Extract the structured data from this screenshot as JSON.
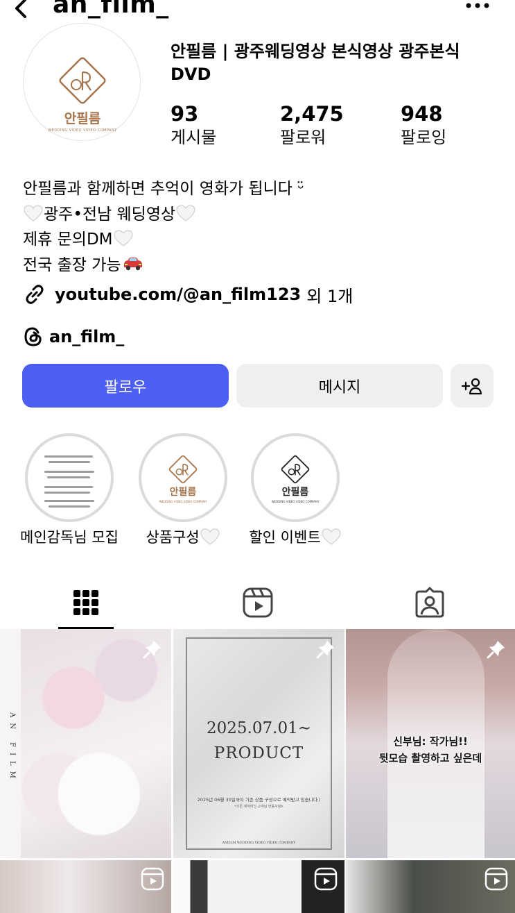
{
  "header": {
    "username": "an_film_"
  },
  "profile": {
    "avatar_logo_word": "안필름",
    "avatar_logo_sub": "WEDDING VIDEO VIDEO COMPANY",
    "display_name": "안필름 | 광주웨딩영상 본식영상 광주본식 DVD",
    "stats": [
      {
        "value": "93",
        "label": "게시물"
      },
      {
        "value": "2,475",
        "label": "팔로워"
      },
      {
        "value": "948",
        "label": "팔로잉"
      }
    ],
    "bio": {
      "line1": "안필름과 함께하면 추억이 영화가 됩니다 ᵕ̈",
      "line2": "광주•전남 웨딩영상",
      "line3": "제휴 문의DM",
      "line4": "전국 출장 가능"
    },
    "link": {
      "text": "youtube.com/@an_film123",
      "more": "외 1개"
    },
    "threads": "an_film_"
  },
  "actions": {
    "follow": "팔로우",
    "message": "메시지"
  },
  "highlights": [
    {
      "label": "메인감독님 모집"
    },
    {
      "label": "상품구성"
    },
    {
      "label": "할인 이벤트"
    }
  ],
  "posts": {
    "p1_vertical_text": "AN FILM",
    "p2_date": "2025.07.01~",
    "p2_product": "PRODUCT",
    "p2_small1": "2025년 06월 30일까지 기존 상품 구성으로 예약받고 있습니다:)",
    "p2_small2": "*기존 계약하신 고객님 변동사항X",
    "p2_footer": "ANFILM WEDDING VIDEO VIDEO COMPANY",
    "p3_caption_line1": "신부님: 작가님!!",
    "p3_caption_line2": "뒷모습 촬영하고 싶은데"
  },
  "colors": {
    "follow_button": "#4c5ff0",
    "secondary_button": "#efeff1",
    "logo_brown": "#a6744b"
  }
}
